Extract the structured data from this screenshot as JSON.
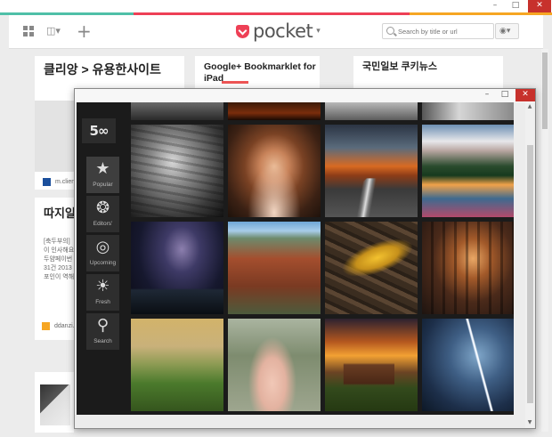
{
  "pocket": {
    "window_controls": {
      "minimize": "–",
      "maximize": "□",
      "close": "✕"
    },
    "stripe_colors": [
      "#4fc0a8",
      "#ee4056",
      "#f6a623"
    ],
    "logo_text": "pocket",
    "search_placeholder": "Search by title or url",
    "tag_caret": "▾",
    "cards": [
      {
        "title": "클리앙 > 유용한사이트",
        "source": "m.clien..."
      },
      {
        "title": "Google+ Bookmarklet for iPad",
        "source": ""
      },
      {
        "title": "국민일보 쿠키뉴스",
        "source": ""
      },
      {
        "title": "따지일",
        "excerpt": [
          "[축두부의]",
          "이 인사해요",
          "두얌페이번",
          "31건 2013",
          "포인이 역해"
        ],
        "source": "ddanzi..."
      }
    ]
  },
  "app500": {
    "window_controls": {
      "minimize": "–",
      "maximize": "□",
      "close": "✕"
    },
    "logo_text": "5∞",
    "nav": [
      {
        "label": "Popular",
        "icon": "star-icon",
        "glyph": "★",
        "active": true
      },
      {
        "label": "Editors'",
        "icon": "award-icon",
        "glyph": "❂",
        "active": false
      },
      {
        "label": "Upcoming",
        "icon": "target-icon",
        "glyph": "◎",
        "active": false
      },
      {
        "label": "Fresh",
        "icon": "sun-icon",
        "glyph": "☀",
        "active": false
      },
      {
        "label": "Search",
        "icon": "search-icon",
        "glyph": "⚲",
        "active": false
      }
    ],
    "photos": [
      {
        "subject": "partial-top-1"
      },
      {
        "subject": "partial-top-2"
      },
      {
        "subject": "partial-top-3"
      },
      {
        "subject": "partial-top-4"
      },
      {
        "subject": "woman-striped-shirt-bw"
      },
      {
        "subject": "girl-portrait"
      },
      {
        "subject": "road-dramatic-sky"
      },
      {
        "subject": "mountain-lake-sunset"
      },
      {
        "subject": "milky-way-coast"
      },
      {
        "subject": "canyon"
      },
      {
        "subject": "yellow-leaf-on-wood"
      },
      {
        "subject": "forest-light-person"
      },
      {
        "subject": "green-hills-fog"
      },
      {
        "subject": "woman-white-dress"
      },
      {
        "subject": "cabin-sunset"
      },
      {
        "subject": "lightning-storm"
      }
    ]
  }
}
